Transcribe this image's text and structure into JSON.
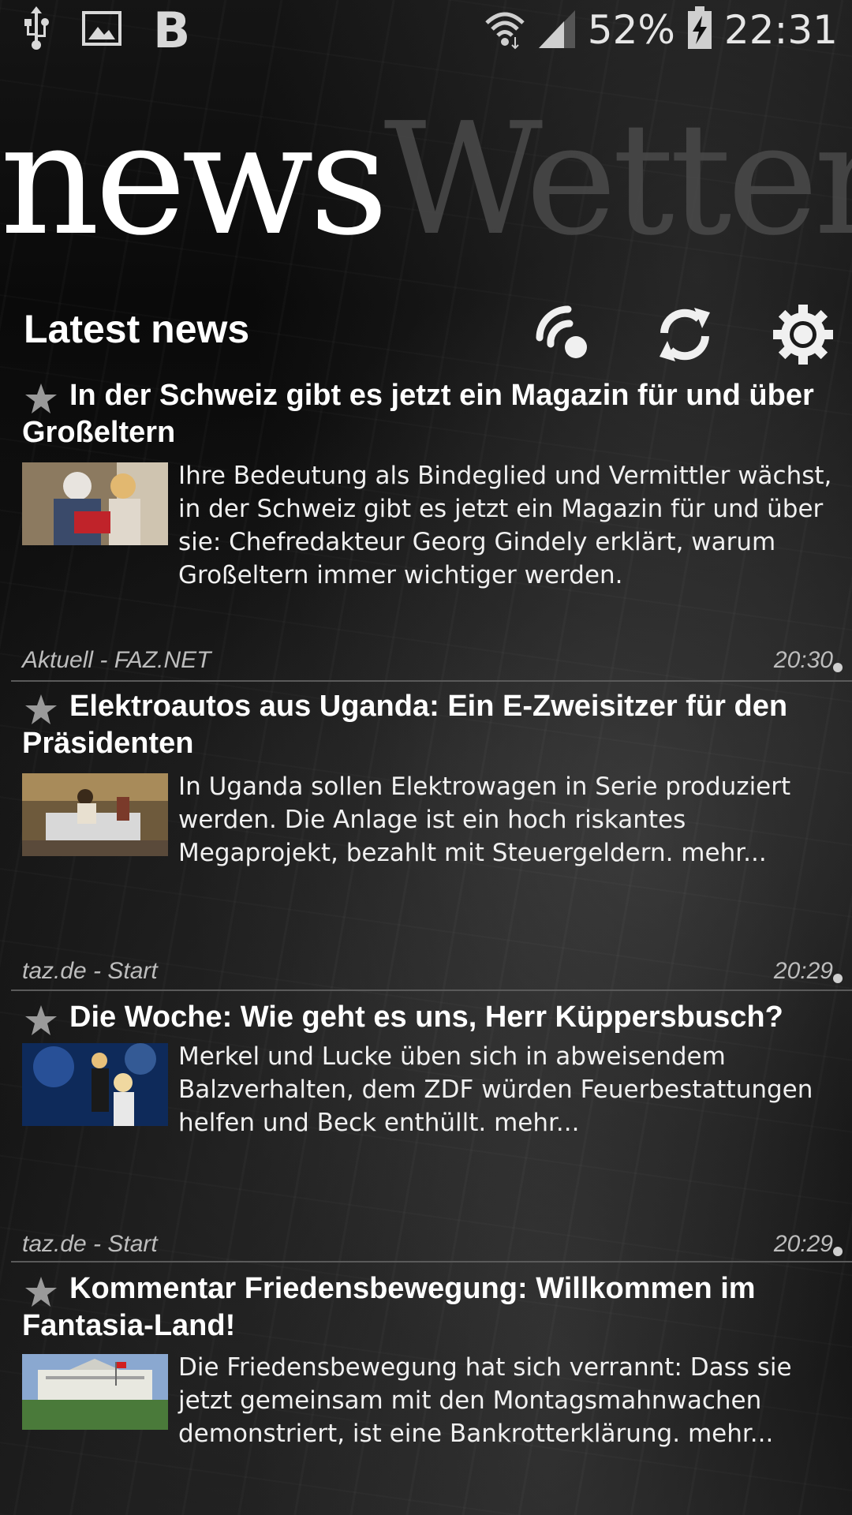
{
  "status_bar": {
    "battery": "52%",
    "time": "22:31",
    "icons": [
      "usb-icon",
      "image-icon",
      "b-app-icon",
      "wifi-icon",
      "signal-icon",
      "battery-charging-icon"
    ]
  },
  "logo": {
    "part1": "news",
    "part2": "Wetter"
  },
  "header": {
    "title": "Latest news",
    "actions": [
      "rss-icon",
      "refresh-icon",
      "settings-icon"
    ]
  },
  "news": [
    {
      "title": "In der Schweiz gibt es jetzt ein Magazin für und über Großeltern",
      "description": "Ihre Bedeutung als Bindeglied und Vermittler wächst, in der Schweiz gibt es jetzt ein Magazin für und über sie: Chefredakteur Georg Gindely erklärt, warum Großeltern immer wichtiger werden.",
      "source": "Aktuell - FAZ.NET",
      "time": "20:30"
    },
    {
      "title": "Elektroautos aus Uganda: Ein E-Zweisitzer für den Präsidenten",
      "description": "In Uganda sollen Elektrowagen in Serie produziert werden. Die Anlage ist ein hoch riskantes Megaprojekt, bezahlt mit Steuergeldern. mehr...",
      "source": "taz.de - Start",
      "time": "20:29"
    },
    {
      "title": "Die Woche: Wie geht es uns, Herr Küppersbusch?",
      "description": "Merkel und Lucke üben sich in abweisendem Balzverhalten, dem ZDF würden Feuerbestattungen helfen und Beck enthüllt. mehr...",
      "source": "taz.de - Start",
      "time": "20:29"
    },
    {
      "title": "Kommentar Friedensbewegung: Willkommen im Fantasia-Land!",
      "description": "Die Friedensbewegung hat sich verrannt: Dass sie jetzt gemeinsam mit den Montagsmahnwachen demonstriert, ist eine Bankrotterklärung. mehr..."
    }
  ]
}
